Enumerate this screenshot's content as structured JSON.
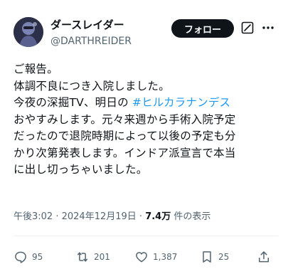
{
  "author": {
    "display_name": "ダースレイダー",
    "handle": "@DARTHREIDER"
  },
  "header": {
    "follow_label": "フォロー",
    "grok_icon": "grok-icon",
    "more_icon": "more-options-icon"
  },
  "tweet": {
    "line1": "ご報告。",
    "line2": "体調不良につき入院しました。",
    "line3_prefix": "今夜の深掘TV、明日の ",
    "hashtag": "#ヒルカラナンデス",
    "line4": "おやすみします。元々来週から手術入院予定",
    "line5": "だったので退院時期によって以後の予定も分",
    "line6": "かり次第発表します。インドア派宣言で本当",
    "line7": "に出し切っちゃいました。"
  },
  "meta": {
    "time": "午後3:02",
    "separator1": " · ",
    "date": "2024年12月19日",
    "separator2": " · ",
    "views_count": "7.4万",
    "views_label": " 件の表示"
  },
  "colors": {
    "hashtag": "#1d9bf0",
    "follow_bg": "#0f1419",
    "secondary_text": "#536471"
  },
  "actions": {
    "replies": "95",
    "reposts": "201",
    "likes": "1,387",
    "bookmarks": "25"
  }
}
